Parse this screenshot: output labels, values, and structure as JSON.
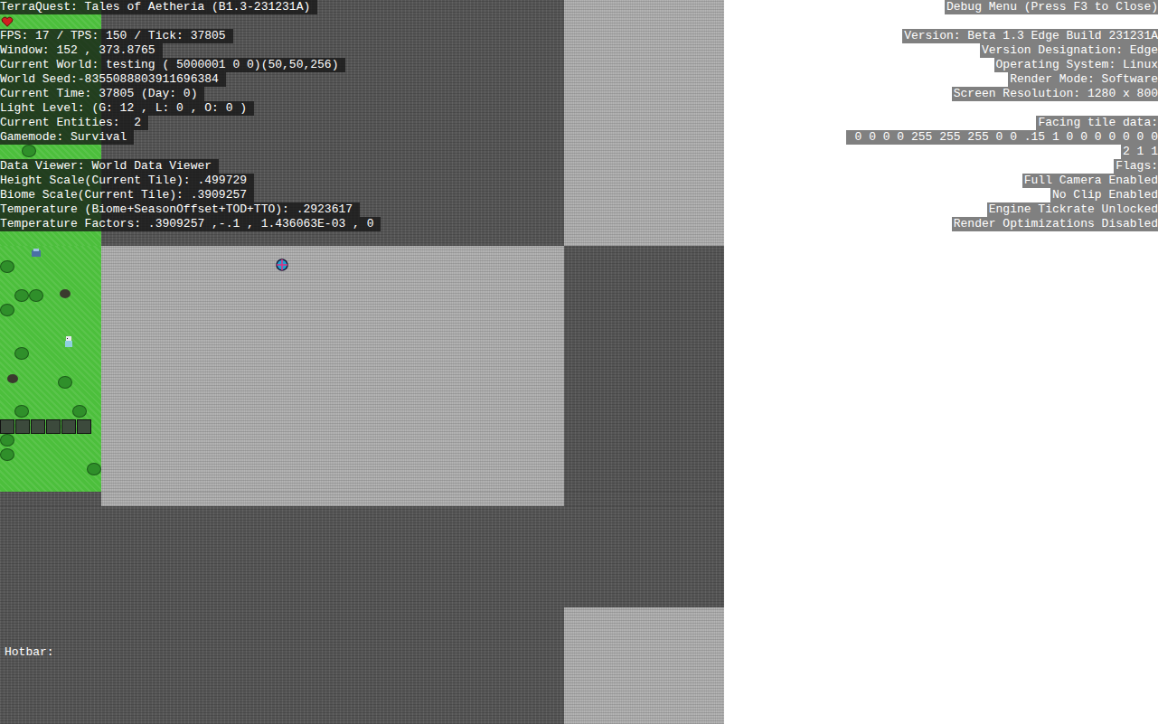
{
  "world": {
    "tiles": [
      [
        "grass",
        "dark",
        "light"
      ],
      [
        "grass",
        "light",
        "dark"
      ],
      [
        "dark",
        "light",
        "dark"
      ],
      [
        "dark",
        "dark",
        "dark"
      ],
      [
        "dark",
        "dark",
        "light"
      ]
    ]
  },
  "debug_left": [
    [
      "TerraQuest: Tales of Aetheria (B1.3-231231A)"
    ],
    [
      "FPS: 17 / TPS: 150 / Tick: 37805",
      "Window: 152 , 373.8765",
      "Current World: testing ( 5000001 0 0)(50,50,256)",
      "World Seed:-8355088803911696384",
      "Current Time: 37805 (Day: 0)",
      "Light Level: (G: 12 , L: 0 , O: 0 )",
      "Current Entities:  2",
      "Gamemode: Survival"
    ],
    [
      "Data Viewer: World Data Viewer",
      "Height Scale(Current Tile): .499729",
      "Biome Scale(Current Tile): .3909257",
      "Temperature (Biome+SeasonOffset+TOD+TTO): .2923617",
      "Temperature Factors: .3909257 ,-.1 , 1.436063E-03 , 0"
    ]
  ],
  "debug_right": [
    [
      "Debug Menu (Press F3 to Close)"
    ],
    [
      "Version: Beta 1.3 Edge Build 231231A",
      "Version Designation: Edge",
      "Operating System: Linux",
      "Render Mode: Software",
      "Screen Resolution: 1280 x 800"
    ],
    [
      "Facing tile data:",
      " 0 0 0 0 255 255 255 0 0 .15 1 0 0 0 0 0 0 0",
      "2 1 1",
      "Flags:",
      "Full Camera Enabled",
      "No Clip Enabled",
      "Engine Tickrate Unlocked",
      "Render Optimizations Disabled"
    ]
  ],
  "hotbar": {
    "label": "Hotbar:"
  }
}
